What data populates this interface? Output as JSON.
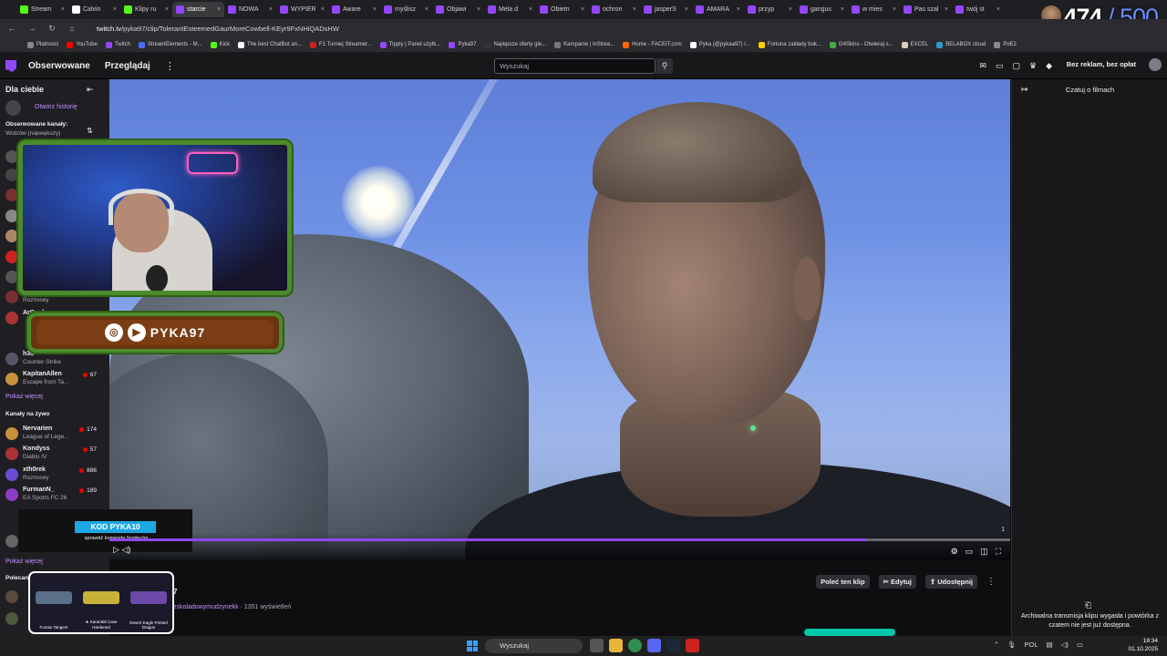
{
  "browser": {
    "tabs": [
      {
        "label": "Stream",
        "color": "#53fc18"
      },
      {
        "label": "Calvin",
        "color": "#ffffff"
      },
      {
        "label": "Klipy ru",
        "color": "#53fc18"
      },
      {
        "label": "starcie",
        "color": "#9147ff",
        "active": true
      },
      {
        "label": "NOWA",
        "color": "#9147ff"
      },
      {
        "label": "WYPIER",
        "color": "#9147ff"
      },
      {
        "label": "Aware",
        "color": "#9147ff"
      },
      {
        "label": "myślisz",
        "color": "#9147ff"
      },
      {
        "label": "Objawi",
        "color": "#9147ff"
      },
      {
        "label": "Mela d",
        "color": "#9147ff"
      },
      {
        "label": "Obietn",
        "color": "#9147ff"
      },
      {
        "label": "ochron",
        "color": "#9147ff"
      },
      {
        "label": "jasperS",
        "color": "#9147ff"
      },
      {
        "label": "AMARA",
        "color": "#9147ff"
      },
      {
        "label": "przyp",
        "color": "#9147ff"
      },
      {
        "label": "gangus",
        "color": "#9147ff"
      },
      {
        "label": "w mies",
        "color": "#9147ff"
      },
      {
        "label": "Pas szal",
        "color": "#9147ff"
      },
      {
        "label": "twój st",
        "color": "#9147ff"
      }
    ],
    "url_host": "twitch.tv",
    "url_path": "/pyka97/clip/TolerantEsteemedGaurMoreCowbell-KEyr9FxNHiQADsHW",
    "bookmarks": [
      "Płatności",
      "YouTube",
      "Twitch",
      "StreamElements - M...",
      "Kick",
      "The best ChatBot an...",
      "F1 Turniej Streamer...",
      "Tipply | Panel użytk...",
      "Pyka97",
      "Najlepsze oferty gie...",
      "Kampanie | inStrea...",
      "Home - FACEIT.com",
      "Pyka (@pykaa97) /...",
      "Fortuna zakłady buk...",
      "G4Skins - Otwieraj s...",
      "EXCEL",
      "BELABOX cloud",
      "PoE2"
    ]
  },
  "overlay": {
    "viewers": "474",
    "slash": "/",
    "max": "500"
  },
  "twitch": {
    "nav_following": "Obserwowane",
    "nav_browse": "Przeglądaj",
    "search_placeholder": "Wyszukaj",
    "prime_label": "Bez reklam, bez opłat"
  },
  "sidebar": {
    "title": "Dla ciebie",
    "history_label": "Otwórz historię",
    "followed_title": "Obserwowane kanały:",
    "followed_sort": "Widzów (największy)",
    "followed_channels": [
      {
        "name": "ibai_",
        "game": "Rozmowy",
        "viewers": "215"
      },
      {
        "name": "ArQuel",
        "game": "",
        "viewers": ""
      },
      {
        "name": "h3o",
        "game": "Counter-Strike",
        "viewers": ""
      },
      {
        "name": "KapitanAllen",
        "game": "Escape from Ta...",
        "viewers": "67"
      }
    ],
    "show_more_1": "Pokaż więcej",
    "live_title": "Kanały na żywo",
    "live_channels": [
      {
        "name": "Nervarien",
        "game": "League of Lege...",
        "viewers": "174",
        "color": "#c7913a"
      },
      {
        "name": "Kondyss",
        "game": "Diablo IV",
        "viewers": "57",
        "color": "#a33"
      },
      {
        "name": "xth0rek",
        "game": "Rozmowy",
        "viewers": "886",
        "color": "#6b4bd1"
      },
      {
        "name": "FurmanN_",
        "game": "EA Sports FC 26",
        "viewers": "189",
        "color": "#8a3cc7"
      }
    ],
    "show_more_2": "Pokaż więcej",
    "recommended_title": "Polecan"
  },
  "overlays": {
    "social_handle": "PYKA97",
    "promo_code": "KOD PYKA10",
    "promo_sub": "sprawdź komendę !logitechg",
    "weapons": [
      {
        "label": "Fumax\nTangent",
        "color": "#5a6f88"
      },
      {
        "label": "★ Karambit\nCase Hardened",
        "color": "#c9b23a"
      },
      {
        "label": "Desert Eagle\nPrinted Dragon",
        "color": "#6c4aa8"
      }
    ]
  },
  "player": {
    "progress": 0.84,
    "time_mark": "1"
  },
  "clip": {
    "title_suffix": "7",
    "channel": "zskoladowymudzynekk",
    "views": "· 1351 wyświetleń",
    "share_clip_label": "Poleć ten klip",
    "edit_label": "Edytuj",
    "share_label": "Udostępnij"
  },
  "chat": {
    "header": "Czatuj o filmach",
    "archived_msg": "Archiwalna transmisja klipu wygasła i powtórka z czatem nie jest już dostępna."
  },
  "taskbar": {
    "search_placeholder": "Wyszukaj",
    "lang": "POL",
    "time": "18:34",
    "date": "01.10.2025"
  }
}
